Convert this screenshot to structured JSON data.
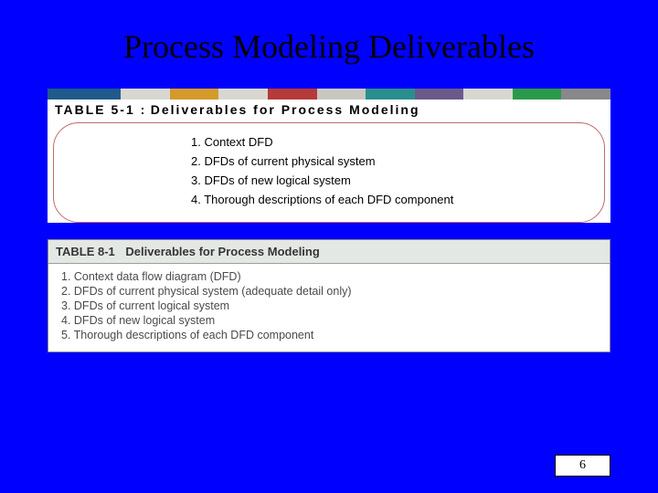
{
  "title": "Process Modeling Deliverables",
  "figure1": {
    "label": "TABLE 5-1 :",
    "caption": "Deliverables for Process Modeling",
    "items": [
      "Context DFD",
      "DFDs of current physical system",
      "DFDs of new logical system",
      "Thorough descriptions of each DFD component"
    ]
  },
  "figure2": {
    "label": "TABLE 8-1",
    "caption": "Deliverables for Process Modeling",
    "items": [
      "Context data flow diagram (DFD)",
      "DFDs of current physical system (adequate detail only)",
      "DFDs of current logical system",
      "DFDs of new logical system",
      "Thorough descriptions of each DFD component"
    ]
  },
  "page_number": "6"
}
